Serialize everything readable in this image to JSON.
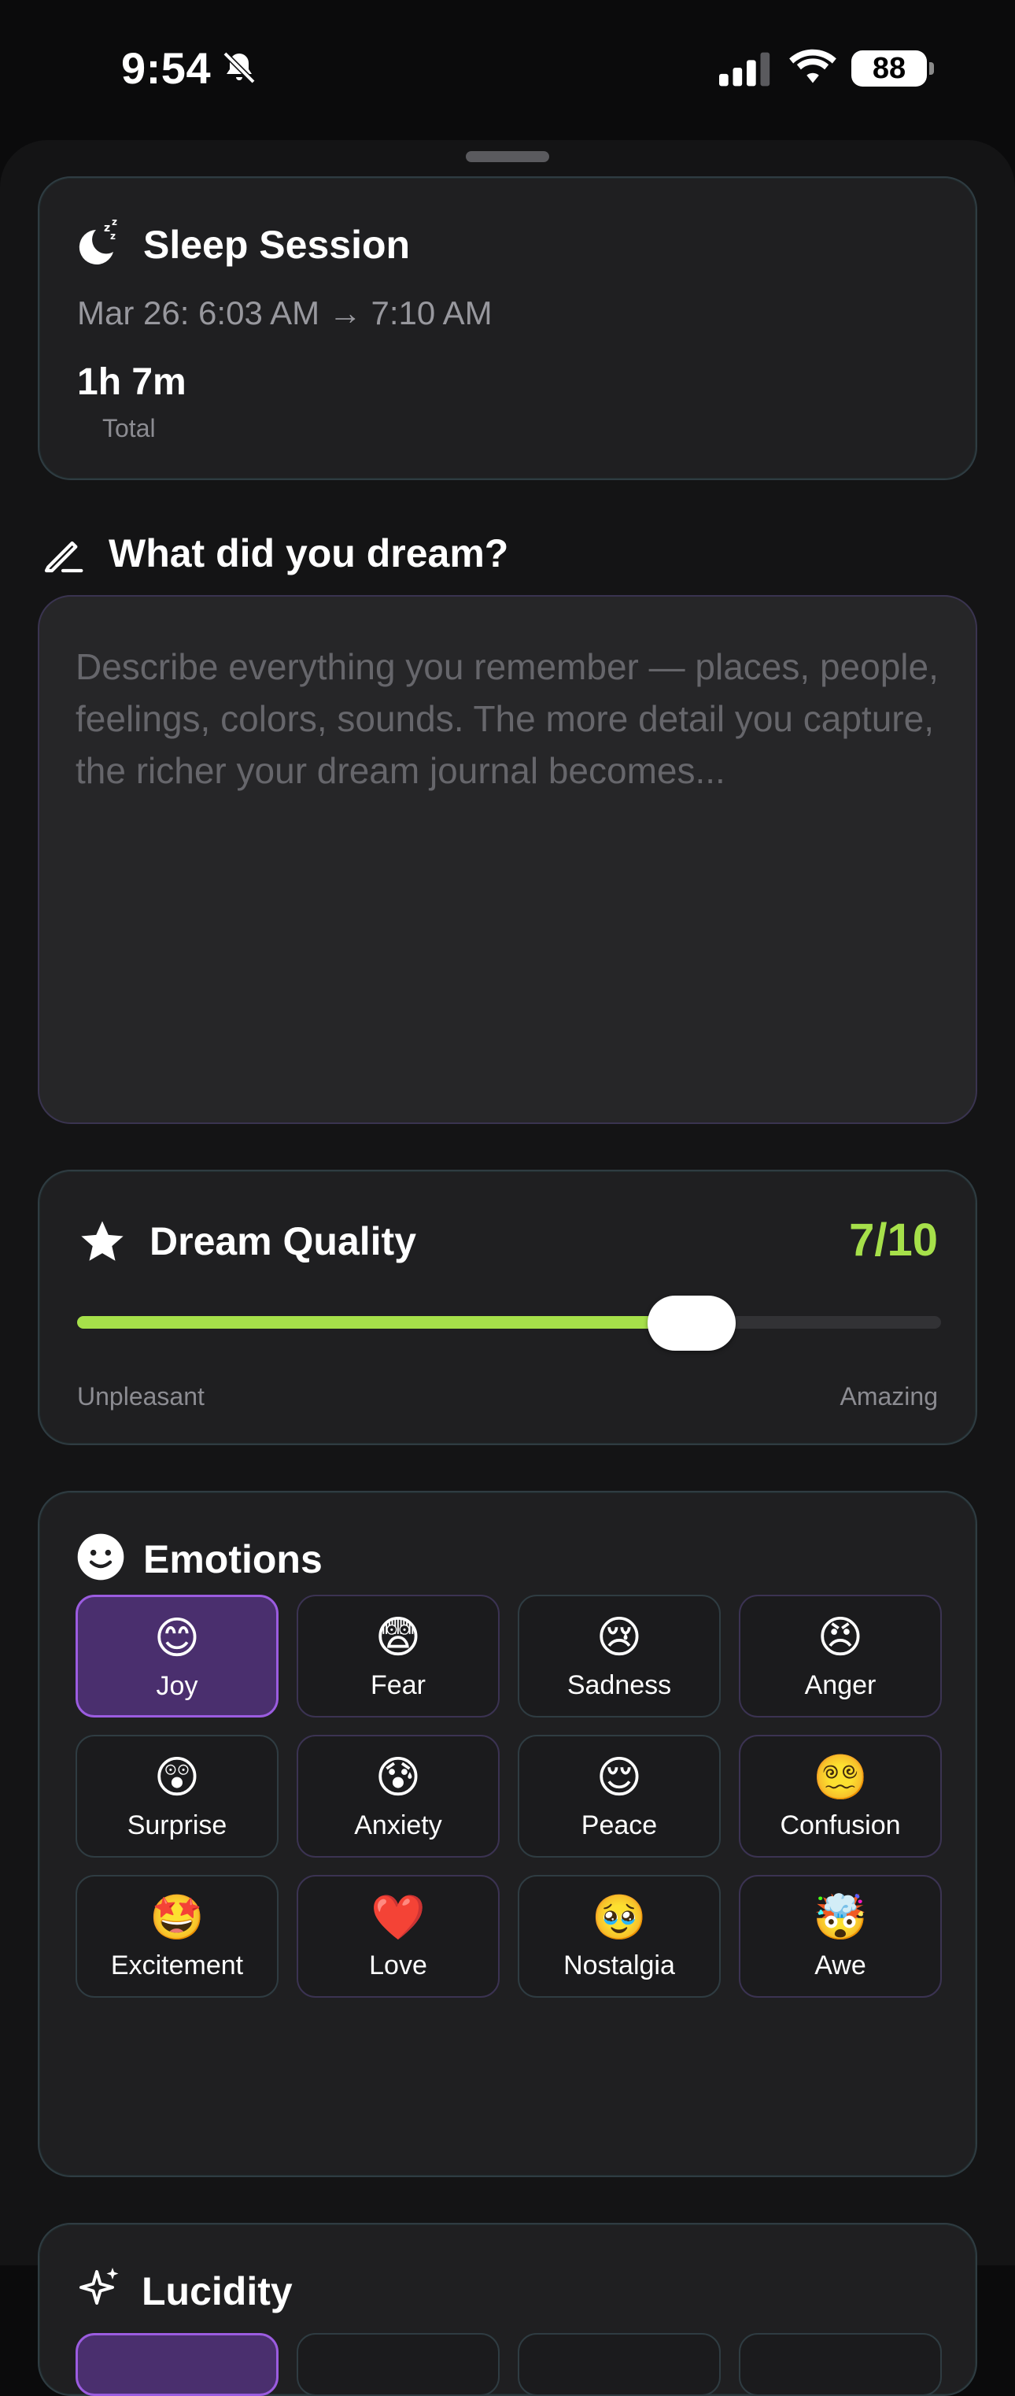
{
  "status_bar": {
    "time": "9:54",
    "battery": "88"
  },
  "sleep_session": {
    "title": "Sleep Session",
    "range": "Mar 26: 6:03 AM → 7:10 AM",
    "duration": "1h 7m",
    "duration_label": "Total"
  },
  "dream_entry": {
    "heading": "What did you dream?",
    "placeholder": "Describe everything you remember — places, people, feelings, colors, sounds. The more detail you capture, the richer your dream journal becomes...",
    "value": ""
  },
  "dream_quality": {
    "title": "Dream Quality",
    "value_label": "7/10",
    "value": 7,
    "max": 10,
    "low_label": "Unpleasant",
    "high_label": "Amazing",
    "accent": "#a6e04a"
  },
  "emotions": {
    "title": "Emotions",
    "selected": "Joy",
    "items": [
      {
        "emoji": "😊",
        "label": "Joy"
      },
      {
        "emoji": "😨",
        "label": "Fear"
      },
      {
        "emoji": "😢",
        "label": "Sadness"
      },
      {
        "emoji": "😠",
        "label": "Anger"
      },
      {
        "emoji": "😲",
        "label": "Surprise"
      },
      {
        "emoji": "😰",
        "label": "Anxiety"
      },
      {
        "emoji": "😌",
        "label": "Peace"
      },
      {
        "emoji": "😵‍💫",
        "label": "Confusion"
      },
      {
        "emoji": "🤩",
        "label": "Excitement"
      },
      {
        "emoji": "❤️",
        "label": "Love"
      },
      {
        "emoji": "🥹",
        "label": "Nostalgia"
      },
      {
        "emoji": "🤯",
        "label": "Awe"
      }
    ],
    "selected_color": "#9b5ce0"
  },
  "lucidity": {
    "title": "Lucidity"
  }
}
